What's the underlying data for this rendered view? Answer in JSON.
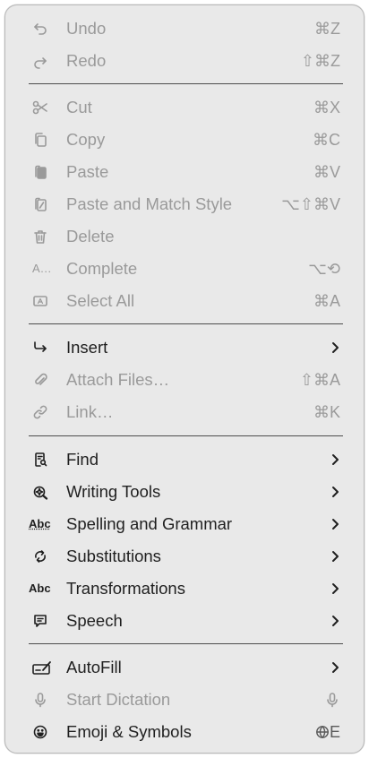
{
  "menu": {
    "undo": {
      "label": "Undo",
      "shortcut": "⌘Z",
      "icon": "undo-icon"
    },
    "redo": {
      "label": "Redo",
      "shortcut": "⇧⌘Z",
      "icon": "redo-icon"
    },
    "cut": {
      "label": "Cut",
      "shortcut": "⌘X",
      "icon": "scissors-icon"
    },
    "copy": {
      "label": "Copy",
      "shortcut": "⌘C",
      "icon": "copy-icon"
    },
    "paste": {
      "label": "Paste",
      "shortcut": "⌘V",
      "icon": "clipboard-icon"
    },
    "paste_match": {
      "label": "Paste and Match Style",
      "shortcut": "⌥⇧⌘V",
      "icon": "paste-style-icon"
    },
    "delete": {
      "label": "Delete",
      "icon": "trash-icon"
    },
    "complete": {
      "label": "Complete",
      "shortcut": "⌥⟲",
      "icon_text": "A…",
      "icon": "complete-icon"
    },
    "select_all": {
      "label": "Select All",
      "shortcut": "⌘A",
      "icon": "select-all-icon"
    },
    "insert": {
      "label": "Insert",
      "icon": "insert-arrow-icon"
    },
    "attach": {
      "label": "Attach Files…",
      "shortcut": "⇧⌘A",
      "icon": "paperclip-icon"
    },
    "link": {
      "label": "Link…",
      "shortcut": "⌘K",
      "icon": "link-icon"
    },
    "find": {
      "label": "Find",
      "icon": "find-icon"
    },
    "writing_tools": {
      "label": "Writing Tools",
      "icon": "writing-tools-icon"
    },
    "spelling": {
      "label": "Spelling and Grammar",
      "icon_text": "Abc",
      "icon": "spelling-icon"
    },
    "substitutions": {
      "label": "Substitutions",
      "icon": "substitution-icon"
    },
    "transformations": {
      "label": "Transformations",
      "icon_text": "Abc",
      "icon": "transform-icon"
    },
    "speech": {
      "label": "Speech",
      "icon": "speech-bubble-icon"
    },
    "autofill": {
      "label": "AutoFill",
      "icon": "autofill-icon"
    },
    "dictation": {
      "label": "Start Dictation",
      "shortcut": "🎤",
      "icon": "microphone-icon"
    },
    "emoji": {
      "label": "Emoji & Symbols",
      "shortcut": "🌐E",
      "icon": "emoji-icon"
    }
  },
  "colors": {
    "enabled": "#1f1f1f",
    "disabled": "#9a9a9a",
    "background": "#e9e9e9",
    "separator": "#4d4d4d"
  }
}
